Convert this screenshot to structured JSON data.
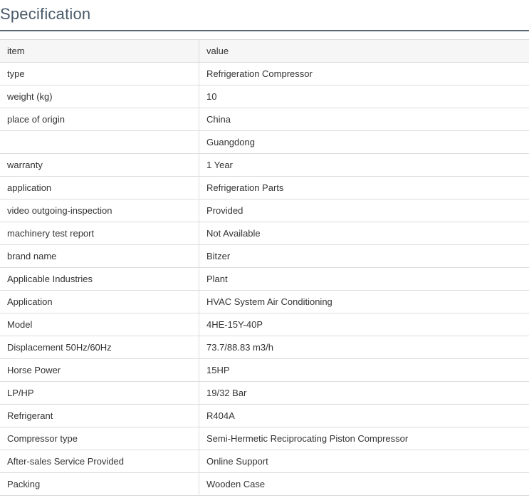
{
  "section": {
    "title": "Specification"
  },
  "table": {
    "header": {
      "key": "item",
      "value": "value"
    },
    "rows": [
      {
        "key": "type",
        "value": "Refrigeration Compressor"
      },
      {
        "key": "weight (kg)",
        "value": "10"
      },
      {
        "key": "place of origin",
        "value": "China"
      },
      {
        "key": "",
        "value": "Guangdong"
      },
      {
        "key": "warranty",
        "value": "1 Year"
      },
      {
        "key": "application",
        "value": "Refrigeration Parts"
      },
      {
        "key": "video outgoing-inspection",
        "value": "Provided"
      },
      {
        "key": "machinery test report",
        "value": "Not Available"
      },
      {
        "key": "brand name",
        "value": "Bitzer"
      },
      {
        "key": "Applicable Industries",
        "value": "Plant"
      },
      {
        "key": "Application",
        "value": "HVAC System Air Conditioning"
      },
      {
        "key": "Model",
        "value": "4HE-15Y-40P"
      },
      {
        "key": "Displacement 50Hz/60Hz",
        "value": "73.7/88.83 m3/h"
      },
      {
        "key": "Horse Power",
        "value": "15HP"
      },
      {
        "key": "LP/HP",
        "value": "19/32 Bar"
      },
      {
        "key": "Refrigerant",
        "value": "R404A"
      },
      {
        "key": "Compressor type",
        "value": "Semi-Hermetic Reciprocating Piston Compressor"
      },
      {
        "key": "After-sales Service Provided",
        "value": "Online Support"
      },
      {
        "key": "Packing",
        "value": "Wooden Case"
      }
    ]
  }
}
